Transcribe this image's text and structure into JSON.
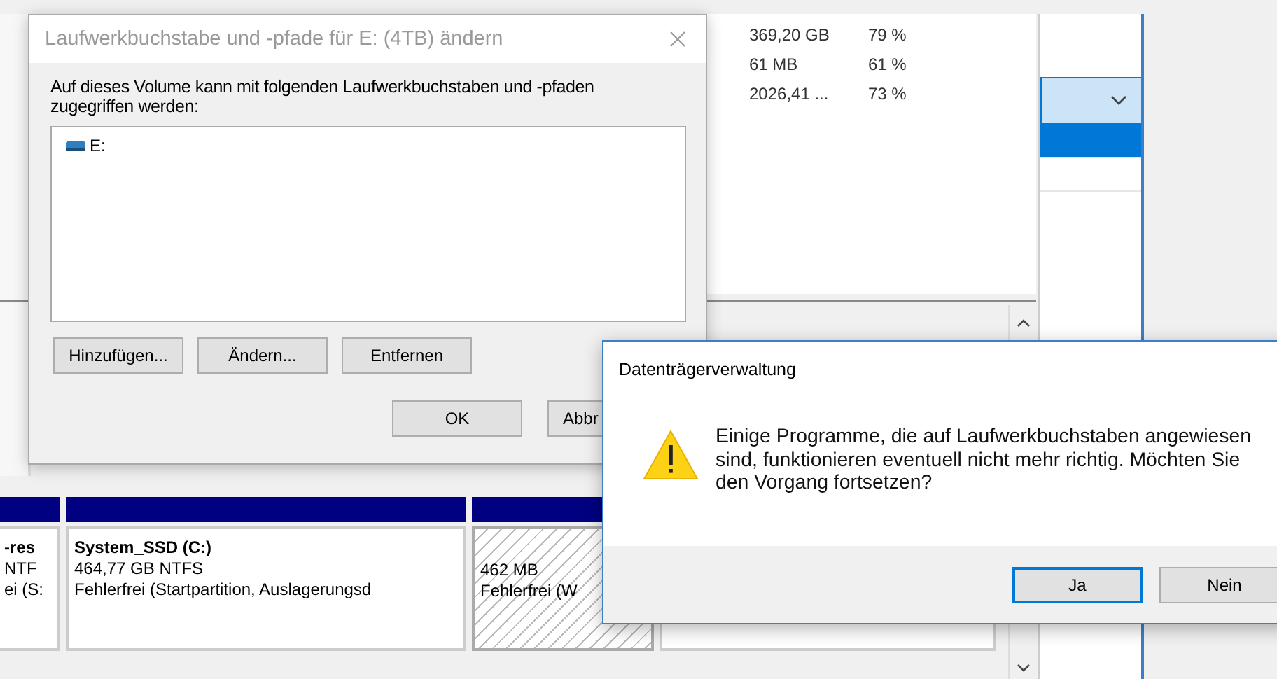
{
  "volume_list": {
    "rows": [
      {
        "capacity": "369,20 GB",
        "free_percent": "79 %"
      },
      {
        "capacity": "61 MB",
        "free_percent": "61 %"
      },
      {
        "capacity": "2026,41 ...",
        "free_percent": "73 %"
      }
    ]
  },
  "side_list": {
    "rows": [
      {
        "selected": true
      },
      {
        "selected": false
      }
    ]
  },
  "disk_map": {
    "partitions": [
      {
        "name": "-res",
        "size": "NTF",
        "status": "ei (S:",
        "selected": false
      },
      {
        "name": "System_SSD  (C:)",
        "size": "464,77 GB NTFS",
        "status": "Fehlerfrei (Startpartition, Auslagerungsd",
        "selected": false
      },
      {
        "size": "462 MB",
        "status": "Fehlerfrei (W",
        "selected": true
      }
    ]
  },
  "drive_letter_dialog": {
    "title": "Laufwerkbuchstabe und -pfade für E: (4TB) ändern",
    "active": false,
    "label": "Auf dieses Volume kann mit folgenden Laufwerkbuchstaben und -pfaden zugegriffen werden:",
    "items": [
      {
        "label": "E:",
        "selected": false
      }
    ],
    "buttons": [
      "Hinzufügen...",
      "Ändern...",
      "Entfernen"
    ],
    "footer_buttons": [
      "OK",
      "Abbr"
    ]
  },
  "confirm_dialog": {
    "title": "Datenträgerverwaltung",
    "active": true,
    "message": "Einige Programme, die auf Laufwerkbuchstaben angewiesen sind, funktionieren eventuell nicht mehr richtig. Möchten Sie den Vorgang fortsetzen?",
    "buttons": [
      {
        "label": "Ja",
        "focused": true
      },
      {
        "label": "Nein",
        "focused": false
      }
    ]
  }
}
